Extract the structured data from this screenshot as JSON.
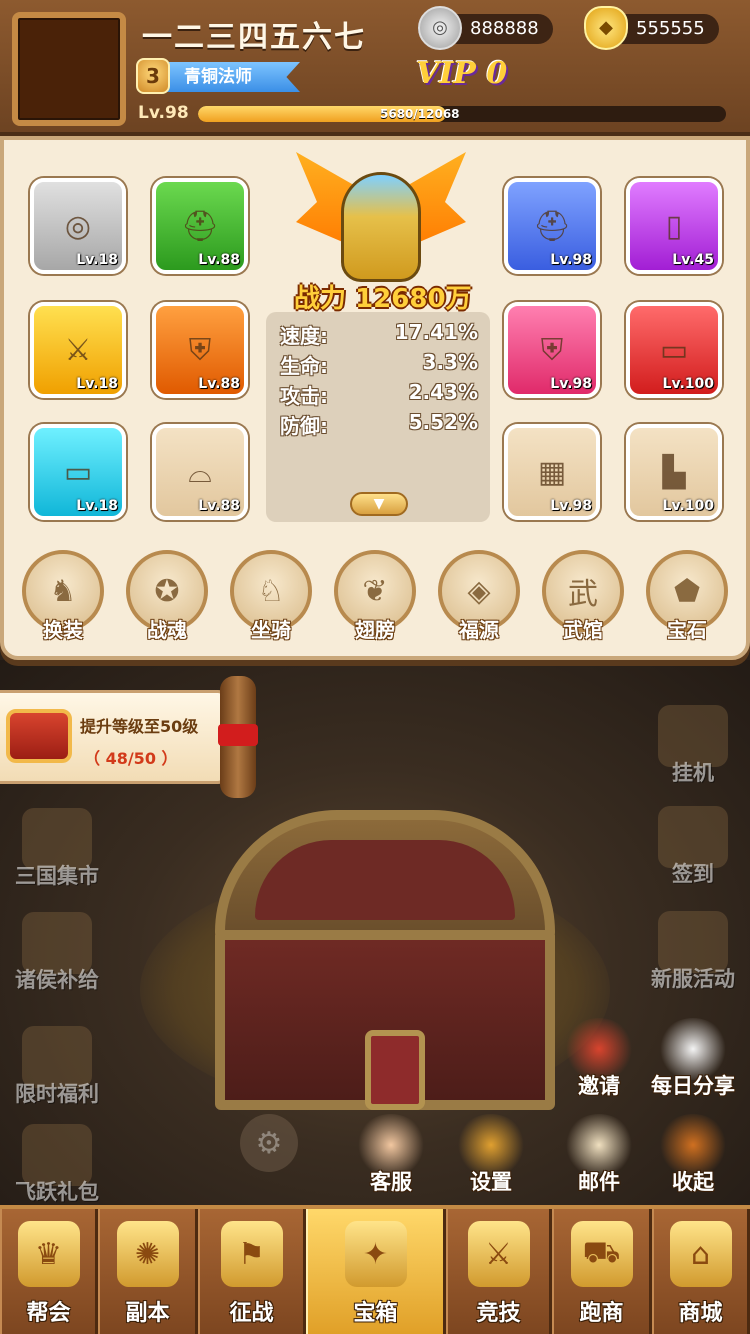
{
  "player": {
    "name": "一二三四五六七",
    "rank_number": "3",
    "rank_title": "青铜法师",
    "level": "Lv.98",
    "exp_text": "5680/12068",
    "exp_fraction": 0.47,
    "vip": "VIP 0"
  },
  "currency": {
    "silver": "888888",
    "gold": "555555"
  },
  "equipment": {
    "left": [
      {
        "level": "Lv.18",
        "quality": "gray",
        "icon": "amulet-icon"
      },
      {
        "level": "Lv.88",
        "quality": "green",
        "icon": "helmet-icon"
      },
      {
        "level": "Lv.18",
        "quality": "yellow",
        "icon": "sword-icon"
      },
      {
        "level": "Lv.88",
        "quality": "orange",
        "icon": "armor-icon"
      },
      {
        "level": "Lv.18",
        "quality": "cyan",
        "icon": "bracer-icon"
      },
      {
        "level": "Lv.88",
        "quality": "beige",
        "icon": "belt-icon"
      }
    ],
    "right": [
      {
        "level": "Lv.98",
        "quality": "blue",
        "icon": "helmet-icon"
      },
      {
        "level": "Lv.45",
        "quality": "purple",
        "icon": "token-icon"
      },
      {
        "level": "Lv.98",
        "quality": "pink",
        "icon": "armor-icon"
      },
      {
        "level": "Lv.100",
        "quality": "red",
        "icon": "bracer-icon"
      },
      {
        "level": "Lv.98",
        "quality": "beige",
        "icon": "gauntlet-icon"
      },
      {
        "level": "Lv.100",
        "quality": "beige",
        "icon": "boots-icon"
      }
    ]
  },
  "hero": {
    "power_label": "战力",
    "power_value": "12680万"
  },
  "stats": [
    {
      "name": "速度:",
      "value": "17.41%"
    },
    {
      "name": "生命:",
      "value": "3.3%"
    },
    {
      "name": "攻击:",
      "value": "2.43%"
    },
    {
      "name": "防御:",
      "value": "5.52%"
    }
  ],
  "functions": [
    {
      "label": "换装",
      "icon": "horse-statue-icon"
    },
    {
      "label": "战魂",
      "icon": "beast-soul-icon"
    },
    {
      "label": "坐骑",
      "icon": "mount-icon"
    },
    {
      "label": "翅膀",
      "icon": "wings-icon"
    },
    {
      "label": "福源",
      "icon": "lantern-icon"
    },
    {
      "label": "武馆",
      "icon": "martial-hall-icon"
    },
    {
      "label": "宝石",
      "icon": "gem-icon"
    }
  ],
  "task": {
    "title": "提升等级至50级",
    "progress": "（ 48/50 ）"
  },
  "side_left": [
    {
      "label": "三国集市",
      "icon": "market-icon"
    },
    {
      "label": "诸侯补给",
      "icon": "supply-bag-icon"
    },
    {
      "label": "限时福利",
      "icon": "treasure-icon"
    },
    {
      "label": "飞跃礼包",
      "icon": "gift-scroll-icon"
    }
  ],
  "side_right": [
    {
      "label": "挂机",
      "icon": "idle-chest-icon"
    },
    {
      "label": "签到",
      "icon": "checkin-icon"
    },
    {
      "label": "新服活动",
      "icon": "drum-icon"
    }
  ],
  "bottom_actions": [
    {
      "label": "邀请",
      "icon": "invite-icon"
    },
    {
      "label": "每日分享",
      "icon": "dove-icon"
    },
    {
      "label": "客服",
      "icon": "service-icon"
    },
    {
      "label": "设置",
      "icon": "settings-icon"
    },
    {
      "label": "邮件",
      "icon": "mail-icon"
    },
    {
      "label": "收起",
      "icon": "collapse-icon"
    }
  ],
  "nav": [
    {
      "label": "帮会",
      "icon": "guild-icon"
    },
    {
      "label": "副本",
      "icon": "dungeon-scroll-icon"
    },
    {
      "label": "征战",
      "icon": "battle-flag-icon"
    },
    {
      "label": "宝箱",
      "icon": "chest-icon"
    },
    {
      "label": "竞技",
      "icon": "crossed-swords-icon"
    },
    {
      "label": "跑商",
      "icon": "cart-icon"
    },
    {
      "label": "商城",
      "icon": "shop-icon"
    }
  ],
  "dim_counter": "1"
}
